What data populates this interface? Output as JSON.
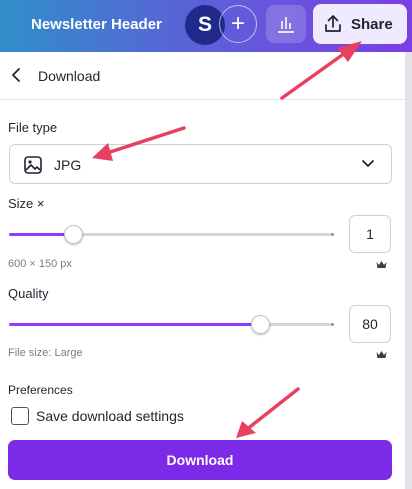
{
  "header": {
    "title": "Newsletter Header",
    "avatar_initial": "S",
    "add_symbol": "+",
    "share_label": "Share",
    "icons": [
      "plus-icon",
      "bar-chart-icon",
      "share-upload-icon"
    ]
  },
  "panel": {
    "title": "Download",
    "file_type": {
      "label": "File type",
      "value": "JPG",
      "icon": "image-icon"
    },
    "size": {
      "label": "Size ×",
      "value": "1",
      "dimensions": "600 × 150 px",
      "slider_fraction": 0.2
    },
    "quality": {
      "label": "Quality",
      "value": "80",
      "file_size": "File size: Large",
      "slider_fraction": 0.78
    },
    "preferences": {
      "label": "Preferences",
      "checkbox_label": "Save download settings",
      "checked": false
    },
    "download_button": "Download"
  },
  "colors": {
    "accent": "#8b3dff",
    "button": "#7d2ae8",
    "annotation_arrow": "#e8405f"
  }
}
